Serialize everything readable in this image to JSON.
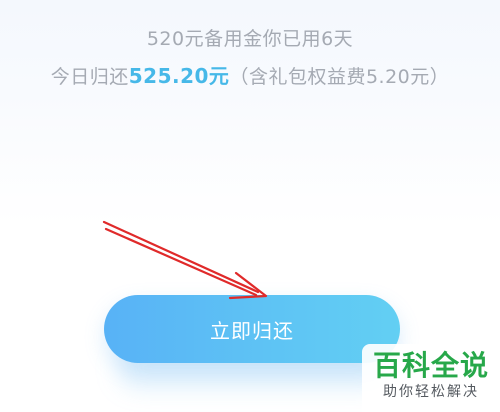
{
  "summary": {
    "line1": "520元备用金你已用6天",
    "line2_prefix": "今日归还",
    "line2_amount": "525.20元",
    "line2_suffix": "（含礼包权益费5.20元）"
  },
  "repay_button": {
    "label": "立即归还"
  },
  "annotation": {
    "arrow_color": "#e02a2a"
  },
  "watermark": {
    "title": "百科全说",
    "subtitle": "助你轻松解决"
  },
  "colors": {
    "accent": "#46b8e8",
    "button_start": "#58b2f6",
    "button_end": "#62cff3",
    "watermark_green": "#27a84a"
  }
}
